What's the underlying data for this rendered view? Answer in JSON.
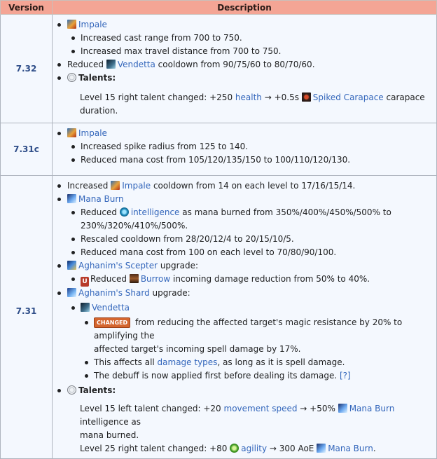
{
  "header": {
    "version": "Version",
    "description": "Description"
  },
  "rows": [
    {
      "version": "7.32",
      "impale": "Impale",
      "impale_sub": [
        "Increased cast range from 700 to 750.",
        "Increased max travel distance from 700 to 750."
      ],
      "reduced_pre": "Reduced ",
      "vendetta": "Vendetta",
      "reduced_post": " cooldown from 90/75/60 to 80/70/60.",
      "talents": "Talents:",
      "talent_pre": "Level 15 right talent changed: +250 ",
      "health": "health",
      "talent_mid": " → +0.5s ",
      "spiked": "Spiked Carapace",
      "talent_post": " carapace duration."
    },
    {
      "version": "7.31c",
      "impale": "Impale",
      "impale_sub": [
        "Increased spike radius from 125 to 140.",
        "Reduced mana cost from 105/120/135/150 to 100/110/120/130."
      ]
    },
    {
      "version": "7.31",
      "inc_pre": "Increased ",
      "impale": "Impale",
      "inc_post": " cooldown from 14 on each level to 17/16/15/14.",
      "mana_burn": "Mana Burn",
      "mb_reduced_pre": "Reduced ",
      "intelligence": "intelligence",
      "mb_reduced_post1": " as mana burned from 350%/400%/450%/500% to",
      "mb_reduced_post2": "230%/320%/410%/500%.",
      "mb_rescaled": "Rescaled cooldown from 28/20/12/4 to 20/15/10/5.",
      "mb_manacost": "Reduced mana cost from 100 on each level to 70/80/90/100.",
      "scepter": "Aghanim's Scepter",
      "upgrade": " upgrade:",
      "u_badge": "U",
      "burrow_pre": "Reduced ",
      "burrow": "Burrow",
      "burrow_post": " incoming damage reduction from 50% to 40%.",
      "shard": "Aghanim's Shard",
      "vendetta": "Vendetta",
      "changed_badge": "CHANGED",
      "changed_text1": " from reducing the affected target's magic resistance by 20% to amplifying the",
      "changed_text2": "affected target's incoming spell damage by 17%.",
      "affects_pre": "This affects all ",
      "damage_types": "damage types",
      "affects_post": ", as long as it is spell damage.",
      "debuff": "The debuff is now applied first before dealing its damage. ",
      "ref": "[?]",
      "talents": "Talents:",
      "t15_pre": "Level 15 left talent changed: +20 ",
      "movement_speed": "movement speed",
      "t15_mid": " → +50% ",
      "t15_manaburn": "Mana Burn",
      "t15_post1": " intelligence as",
      "t15_post2": "mana burned.",
      "t25_pre": "Level 25 right talent changed: +80 ",
      "agility": "agility",
      "t25_mid": " → 300 AoE ",
      "t25_manaburn": "Mana Burn",
      "t25_post": "."
    }
  ]
}
